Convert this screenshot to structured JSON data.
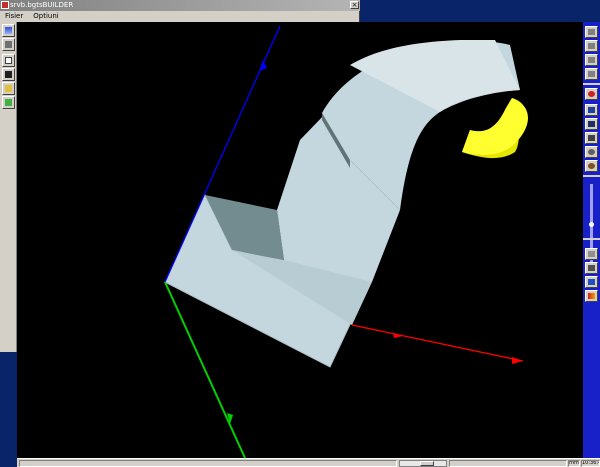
{
  "window": {
    "title": "srvb.bgtsBUILDER"
  },
  "menu": [
    {
      "label": "Fisier"
    },
    {
      "label": "Optiuni"
    }
  ],
  "left_toolbar": [
    {
      "icon": "view-icon"
    },
    {
      "icon": "layers-icon"
    },
    {
      "icon": "new-file-icon"
    },
    {
      "icon": "save-icon"
    },
    {
      "icon": "open-folder-icon"
    },
    {
      "icon": "exit-icon"
    }
  ],
  "right_toolbar": {
    "top": [
      {
        "icon": "view-front-icon"
      },
      {
        "icon": "view-side-icon"
      },
      {
        "icon": "view-top-icon"
      },
      {
        "icon": "view-iso-icon"
      }
    ],
    "middle": [
      {
        "icon": "stop-icon"
      },
      {
        "icon": "chart-icon"
      },
      {
        "icon": "rotate-icon"
      },
      {
        "icon": "pan-icon"
      },
      {
        "icon": "zoom-icon"
      },
      {
        "icon": "render-icon"
      }
    ],
    "bottom": [
      {
        "icon": "check-icon"
      },
      {
        "icon": "measure-icon"
      },
      {
        "icon": "info-icon"
      },
      {
        "icon": "palette-icon"
      }
    ]
  },
  "status": {
    "units": "mm",
    "time": "10:36:40"
  },
  "colors": {
    "background": "#000000",
    "x_axis": "#ff0000",
    "y_axis": "#00ff00",
    "z_axis": "#0000ff",
    "solid": "#c4d6de",
    "highlight": "#ffff00"
  }
}
